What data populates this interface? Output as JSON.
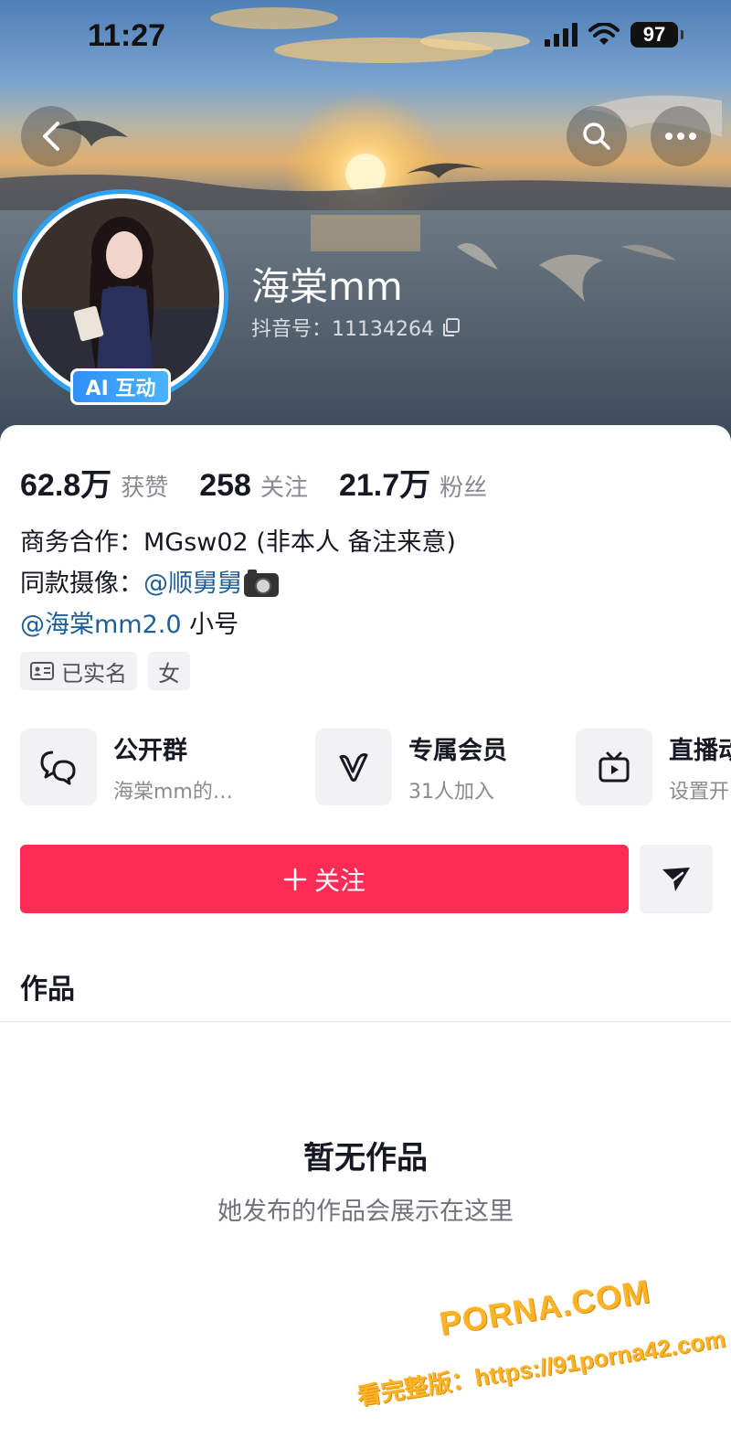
{
  "status_bar": {
    "time": "11:27",
    "battery": "97"
  },
  "header": {
    "nickname": "海棠mm",
    "douyin_id": "抖音号：11134264",
    "ai_badge": "AI 互动"
  },
  "stats": [
    {
      "value": "62.8万",
      "label": "获赞"
    },
    {
      "value": "258",
      "label": "关注"
    },
    {
      "value": "21.7万",
      "label": "粉丝"
    }
  ],
  "bio": {
    "line1": "商务合作：MGsw02   (非本人 备注来意)",
    "line2_prefix": "同款摄像：",
    "line2_link": "@顺舅舅",
    "line3_link": "@海棠mm2.0",
    "line3_suffix": " 小号"
  },
  "tags": {
    "verified": "已实名",
    "gender": "女"
  },
  "features": [
    {
      "title": "公开群",
      "subtitle": "海棠mm的…",
      "icon": "chat-bubbles-icon"
    },
    {
      "title": "专属会员",
      "subtitle": "31人加入",
      "icon": "v-badge-icon"
    },
    {
      "title": "直播动",
      "subtitle": "设置开",
      "icon": "tv-icon"
    }
  ],
  "actions": {
    "follow_label": "关注"
  },
  "tabs": {
    "works": "作品"
  },
  "empty_state": {
    "title": "暂无作品",
    "subtitle": "她发布的作品会展示在这里"
  },
  "watermark": {
    "line1": "PORNA.COM",
    "line2": "看完整版：https://91porna42.com"
  },
  "colors": {
    "follow": "#fe2c55",
    "link": "#1f5f97",
    "badge": "#2f8ff7"
  }
}
